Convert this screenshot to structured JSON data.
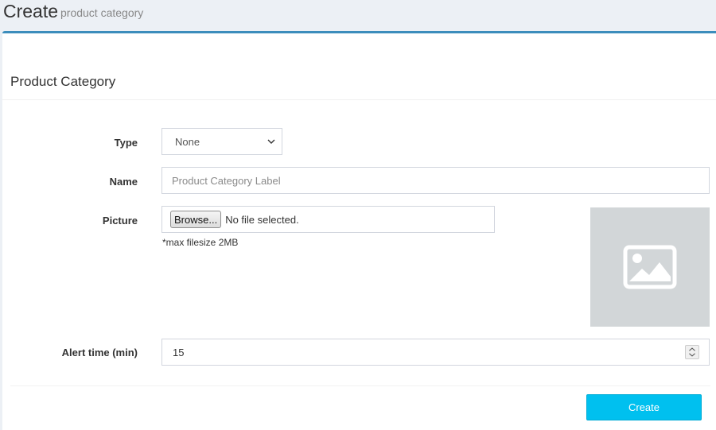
{
  "header": {
    "title": "Create",
    "subtitle": "product category"
  },
  "box": {
    "title": "Product Category"
  },
  "form": {
    "type": {
      "label": "Type",
      "selected": "None"
    },
    "name": {
      "label": "Name",
      "value": "",
      "placeholder": "Product Category Label"
    },
    "picture": {
      "label": "Picture",
      "browse_label": "Browse...",
      "file_status": "No file selected.",
      "hint": "*max filesize 2MB",
      "preview_icon": "image-icon"
    },
    "alert_time": {
      "label": "Alert time (min)",
      "value": "15"
    }
  },
  "actions": {
    "create_label": "Create"
  },
  "colors": {
    "accent": "#3c8dbc",
    "button": "#00c0ef",
    "background": "#ecf0f5",
    "placeholder_bg": "#d2d6d8"
  }
}
